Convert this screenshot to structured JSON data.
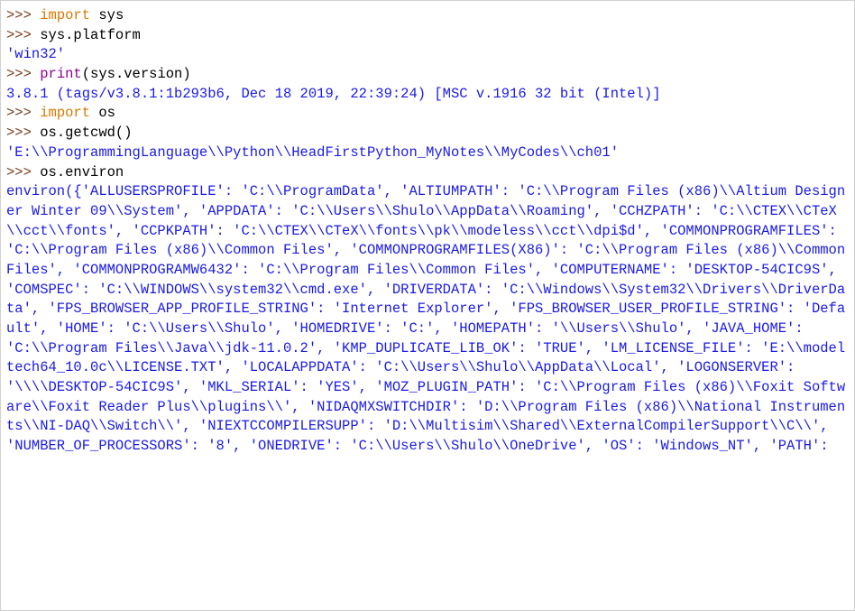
{
  "l1": {
    "prompt": ">>> ",
    "kw": "import",
    "sp": " ",
    "mod": "sys"
  },
  "l2": {
    "prompt": ">>> ",
    "txt": "sys.platform"
  },
  "l3": {
    "out": "'win32'"
  },
  "l4": {
    "prompt": ">>> ",
    "fn": "print",
    "arg": "(sys.version)"
  },
  "l5": {
    "out": "3.8.1 (tags/v3.8.1:1b293b6, Dec 18 2019, 22:39:24) [MSC v.1916 32 bit (Intel)]"
  },
  "l6": {
    "prompt": ">>> ",
    "kw": "import",
    "sp": " ",
    "mod": "os"
  },
  "l7": {
    "prompt": ">>> ",
    "txt": "os.getcwd()"
  },
  "l8": {
    "out": "'E:\\\\ProgrammingLanguage\\\\Python\\\\HeadFirstPython_MyNotes\\\\MyCodes\\\\ch01'"
  },
  "l9": {
    "prompt": ">>> ",
    "txt": "os.environ"
  },
  "l10": {
    "out": "environ({'ALLUSERSPROFILE': 'C:\\\\ProgramData', 'ALTIUMPATH': 'C:\\\\Program Files (x86)\\\\Altium Designer Winter 09\\\\System', 'APPDATA': 'C:\\\\Users\\\\Shulo\\\\AppData\\\\Roaming', 'CCHZPATH': 'C:\\\\CTEX\\\\CTeX\\\\cct\\\\fonts', 'CCPKPATH': 'C:\\\\CTEX\\\\CTeX\\\\fonts\\\\pk\\\\modeless\\\\cct\\\\dpi$d', 'COMMONPROGRAMFILES': 'C:\\\\Program Files (x86)\\\\Common Files', 'COMMONPROGRAMFILES(X86)': 'C:\\\\Program Files (x86)\\\\Common Files', 'COMMONPROGRAMW6432': 'C:\\\\Program Files\\\\Common Files', 'COMPUTERNAME': 'DESKTOP-54CIC9S', 'COMSPEC': 'C:\\\\WINDOWS\\\\system32\\\\cmd.exe', 'DRIVERDATA': 'C:\\\\Windows\\\\System32\\\\Drivers\\\\DriverData', 'FPS_BROWSER_APP_PROFILE_STRING': 'Internet Explorer', 'FPS_BROWSER_USER_PROFILE_STRING': 'Default', 'HOME': 'C:\\\\Users\\\\Shulo', 'HOMEDRIVE': 'C:', 'HOMEPATH': '\\\\Users\\\\Shulo', 'JAVA_HOME': 'C:\\\\Program Files\\\\Java\\\\jdk-11.0.2', 'KMP_DUPLICATE_LIB_OK': 'TRUE', 'LM_LICENSE_FILE': 'E:\\\\modeltech64_10.0c\\\\LICENSE.TXT', 'LOCALAPPDATA': 'C:\\\\Users\\\\Shulo\\\\AppData\\\\Local', 'LOGONSERVER': '\\\\\\\\DESKTOP-54CIC9S', 'MKL_SERIAL': 'YES', 'MOZ_PLUGIN_PATH': 'C:\\\\Program Files (x86)\\\\Foxit Software\\\\Foxit Reader Plus\\\\plugins\\\\', 'NIDAQMXSWITCHDIR': 'D:\\\\Program Files (x86)\\\\National Instruments\\\\NI-DAQ\\\\Switch\\\\', 'NIEXTCCOMPILERSUPP': 'D:\\\\Multisim\\\\Shared\\\\ExternalCompilerSupport\\\\C\\\\', 'NUMBER_OF_PROCESSORS': '8', 'ONEDRIVE': 'C:\\\\Users\\\\Shulo\\\\OneDrive', 'OS': 'Windows_NT', 'PATH':"
  }
}
